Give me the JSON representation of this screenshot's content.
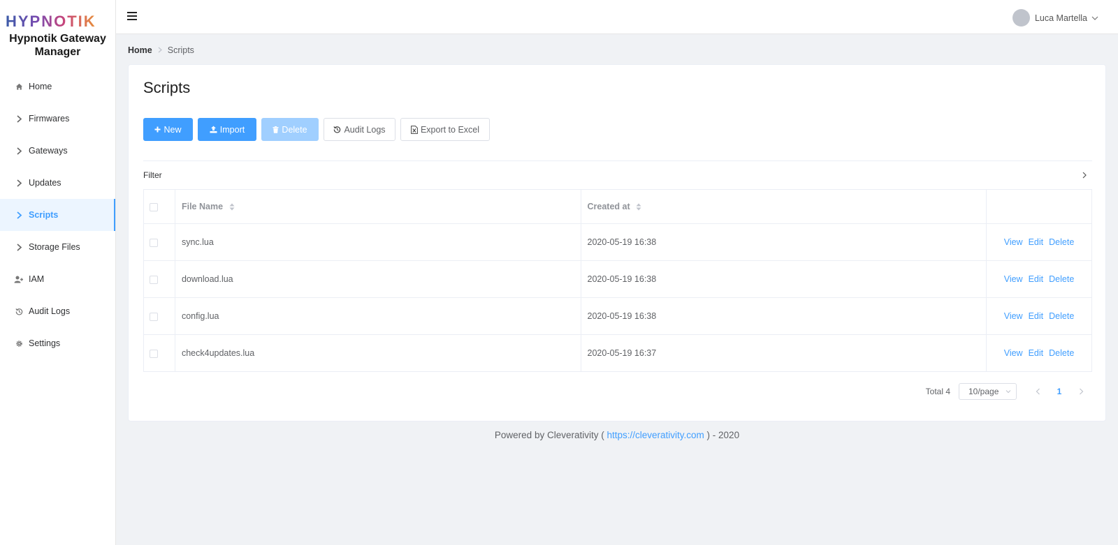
{
  "sidebar": {
    "logo": "HYPNOTIK",
    "app_title": "Hypnotik Gateway Manager",
    "items": [
      {
        "label": "Home",
        "icon": "home-icon"
      },
      {
        "label": "Firmwares",
        "icon": "chevron-right-icon"
      },
      {
        "label": "Gateways",
        "icon": "chevron-right-icon"
      },
      {
        "label": "Updates",
        "icon": "chevron-right-icon"
      },
      {
        "label": "Scripts",
        "icon": "chevron-right-icon",
        "active": true
      },
      {
        "label": "Storage Files",
        "icon": "chevron-right-icon"
      },
      {
        "label": "IAM",
        "icon": "user-plus-icon"
      },
      {
        "label": "Audit Logs",
        "icon": "history-icon"
      },
      {
        "label": "Settings",
        "icon": "gear-icon"
      }
    ]
  },
  "header": {
    "user_name": "Luca Martella"
  },
  "breadcrumb": {
    "home": "Home",
    "current": "Scripts"
  },
  "page": {
    "title": "Scripts"
  },
  "toolbar": {
    "new_label": "New",
    "import_label": "Import",
    "delete_label": "Delete",
    "audit_label": "Audit Logs",
    "export_label": "Export to Excel"
  },
  "filter": {
    "label": "Filter"
  },
  "table": {
    "columns": [
      "File Name",
      "Created at"
    ],
    "rows": [
      {
        "file": "sync.lua",
        "created": "2020-05-19 16:38"
      },
      {
        "file": "download.lua",
        "created": "2020-05-19 16:38"
      },
      {
        "file": "config.lua",
        "created": "2020-05-19 16:38"
      },
      {
        "file": "check4updates.lua",
        "created": "2020-05-19 16:37"
      }
    ],
    "actions": [
      "View",
      "Edit",
      "Delete"
    ]
  },
  "pagination": {
    "total": "Total 4",
    "page_size": "10/page",
    "current_page": "1"
  },
  "footer": {
    "prefix": "Powered by Cleverativity (",
    "link": "https://cleverativity.com",
    "suffix": ") - 2020"
  },
  "colors": {
    "primary": "#409eff",
    "primary_disabled": "#a0cfff",
    "background": "#f0f2f5"
  }
}
